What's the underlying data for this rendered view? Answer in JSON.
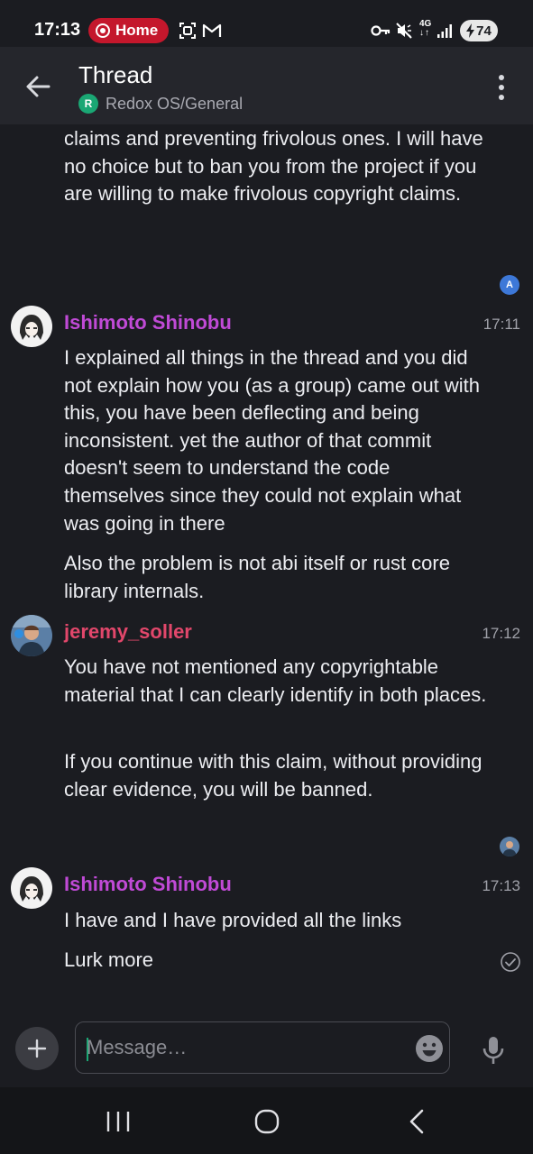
{
  "status_bar": {
    "time": "17:13",
    "home_label": "Home",
    "battery": "74",
    "network": "4G"
  },
  "app_bar": {
    "title": "Thread",
    "room_initial": "R",
    "room_name": "Redox OS/General"
  },
  "messages": {
    "m0_text": "claims and preventing frivolous ones. I will have no choice but to ban you from the project if you are willing to make frivolous copyright claims.",
    "read_receipt_1_initial": "A",
    "m1_sender": "Ishimoto Shinobu",
    "m1_time": "17:11",
    "m1_text_1": "I explained all things in the thread and you did not explain how you (as a group) came out with this, you have been deflecting and being inconsistent. yet the author of that commit doesn't seem to understand the code themselves since they could not explain what was going in there",
    "m1_text_2": "Also the problem is not abi itself or rust core library internals.",
    "m2_sender": "jeremy_soller",
    "m2_time": "17:12",
    "m2_text_1": "You have not mentioned any copyrightable material that I can clearly identify in both places.",
    "m2_text_2": "If you continue with this claim, without providing clear evidence, you will be banned.",
    "m3_sender": "Ishimoto Shinobu",
    "m3_time": "17:13",
    "m3_text_1": "I have and I have provided all the links",
    "m3_text_2": "Lurk more"
  },
  "composer": {
    "placeholder": "Message…"
  },
  "colors": {
    "background": "#1b1c21",
    "app_bar": "#25262c",
    "accent_green": "#1aa774",
    "sender_purple": "#c04ad6",
    "sender_red": "#e2476b",
    "home_pill": "#c4172c"
  }
}
